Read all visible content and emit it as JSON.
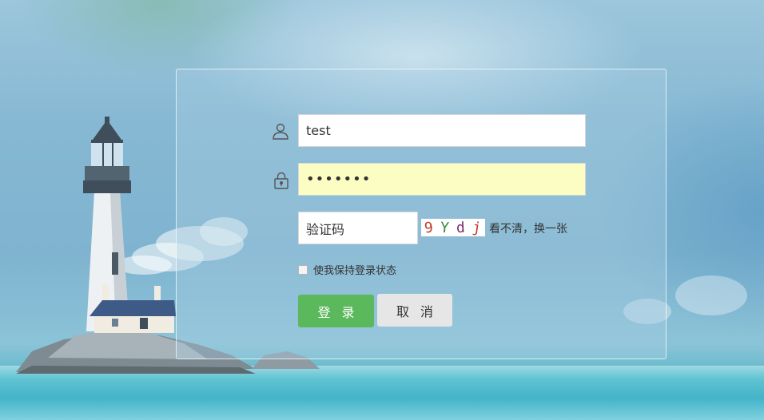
{
  "login_form": {
    "username": {
      "icon": "user-icon",
      "value": "test"
    },
    "password": {
      "icon": "lock-icon",
      "value": "•••••••",
      "background": "#fbfdc2"
    },
    "captcha": {
      "placeholder": "验证码",
      "chars": [
        "9",
        "Y",
        "d",
        "j"
      ],
      "char_colors": [
        "#c0392b",
        "#2e8b3c",
        "#7a2b6a",
        "#c0392b"
      ],
      "refresh_label": "看不清，换一张"
    },
    "remember_label": "使我保持登录状态",
    "login_button": "登录",
    "cancel_button": "取消"
  },
  "colors": {
    "login_button": "#5cb85c",
    "cancel_button": "#e6e6e6",
    "panel_border": "#ffffff"
  }
}
